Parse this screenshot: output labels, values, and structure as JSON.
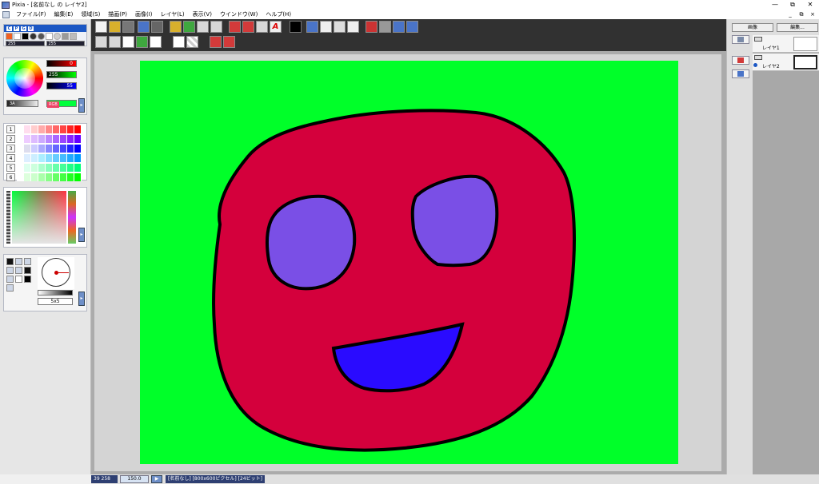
{
  "window": {
    "title": "Pixia - [名前なし の レイヤ2]",
    "minimize": "—",
    "restore": "⧉",
    "close": "✕"
  },
  "menubar": {
    "items": [
      "ファイル(F)",
      "編集(E)",
      "領域(S)",
      "描画(P)",
      "画像(I)",
      "レイヤ(L)",
      "表示(V)",
      "ウインドウ(W)",
      "ヘルプ(H)"
    ],
    "mdi": [
      "_",
      "⧉",
      "×"
    ]
  },
  "toolmodes": {
    "mode_labels": [
      "C",
      "P",
      "G",
      "D"
    ],
    "size_a": "255",
    "size_b": "255"
  },
  "color": {
    "r": "0",
    "g": "255",
    "b": "55",
    "alpha_label": "3A",
    "mode": "RGB",
    "current_hex": "#00ff37",
    "more": "▸"
  },
  "palette": {
    "rows": [
      "1",
      "2",
      "3",
      "4",
      "5",
      "6"
    ]
  },
  "brush": {
    "size": "5x5"
  },
  "canvas": {
    "background": "#00ff29",
    "face_color": "#d4003c",
    "eye_color": "#7a4fe6",
    "mouth_color": "#2a0bff",
    "outline_color": "#000000"
  },
  "right": {
    "image_btn": "画像",
    "edit_btn": "編集...",
    "layers": [
      {
        "name": "レイヤ1"
      },
      {
        "name": "レイヤ2"
      }
    ]
  },
  "status": {
    "coords": "39 258",
    "zoom": "150.0",
    "play": "▶",
    "info": "[名前なし] [800x600ピクセル] [24ビット]"
  }
}
